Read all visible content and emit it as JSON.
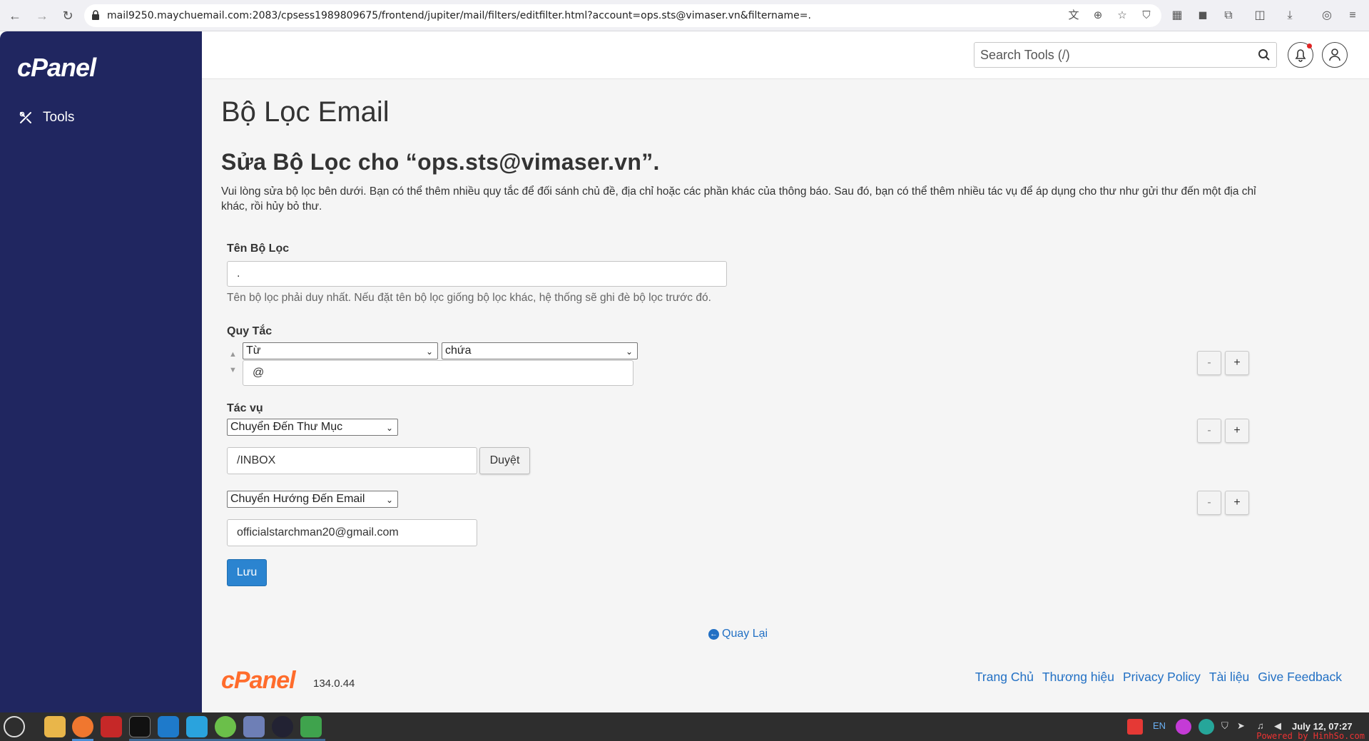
{
  "browser": {
    "url": "mail9250.maychuemail.com:2083/cpsess1989809675/frontend/jupiter/mail/filters/editfilter.html?account=ops.sts@vimaser.vn&filtername=."
  },
  "sidebar": {
    "logo": "cPanel",
    "items": [
      {
        "label": "Tools",
        "icon": "tools-icon"
      }
    ]
  },
  "header": {
    "search_placeholder": "Search Tools (/)"
  },
  "page": {
    "title": "Bộ Lọc Email",
    "subtitle": "Sửa Bộ Lọc cho “ops.sts@vimaser.vn”.",
    "description": "Vui lòng sửa bộ lọc bên dưới. Bạn có thể thêm nhiều quy tắc để đối sánh chủ đề, địa chỉ hoặc các phần khác của thông báo. Sau đó, bạn có thể thêm nhiều tác vụ để áp dụng cho thư như gửi thư đến một địa chỉ khác, rồi hủy bỏ thư."
  },
  "form": {
    "filter_name_label": "Tên Bộ Lọc",
    "filter_name_value": ".",
    "filter_name_help": "Tên bộ lọc phải duy nhất. Nếu đặt tên bộ lọc giống bộ lọc khác, hệ thống sẽ ghi đè bộ lọc trước đó.",
    "rules_label": "Quy Tắc",
    "rule": {
      "field": "Từ",
      "operator": "chứa",
      "value": "@"
    },
    "actions_label": "Tác vụ",
    "actions": [
      {
        "type": "Chuyển Đến Thư Mục",
        "value": "/INBOX",
        "browse_label": "Duyệt"
      },
      {
        "type": "Chuyển Hướng Đến Email",
        "value": "officialstarchman20@gmail.com"
      }
    ],
    "minus_label": "-",
    "plus_label": "+",
    "save_label": "Lưu"
  },
  "back_link": "Quay Lại",
  "footer": {
    "logo": "cPanel",
    "version": "134.0.44",
    "links": [
      "Trang Chủ",
      "Thương hiệu",
      "Privacy Policy",
      "Tài liệu",
      "Give Feedback"
    ]
  },
  "taskbar": {
    "language": "EN",
    "clock": "July 12, 07:27",
    "watermark": "Powered by HinhSo.com"
  }
}
